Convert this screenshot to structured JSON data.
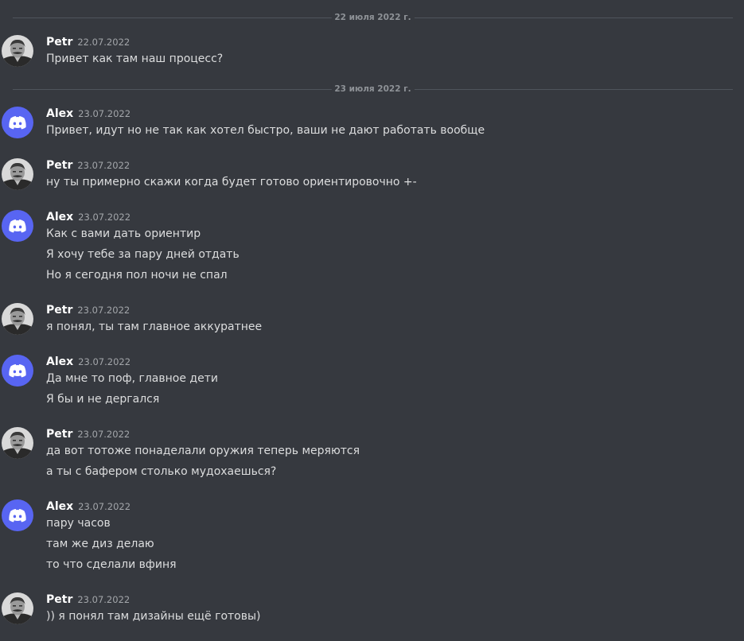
{
  "separators": [
    {
      "label": "22 июля 2022 г."
    },
    {
      "label": "23 июля 2022 г."
    }
  ],
  "messages": [
    {
      "author": "Petr",
      "timestamp": "22.07.2022",
      "avatar_icon": "portrait-avatar-icon",
      "lines": [
        "Привет как там наш процесс?"
      ]
    },
    {
      "author": "Alex",
      "timestamp": "23.07.2022",
      "avatar_icon": "discord-logo-icon",
      "lines": [
        "Привет, идут но не так как хотел быстро, ваши не дают работать вообще"
      ]
    },
    {
      "author": "Petr",
      "timestamp": "23.07.2022",
      "avatar_icon": "portrait-avatar-icon",
      "lines": [
        "ну ты примерно скажи когда будет готово ориентировочно +-"
      ]
    },
    {
      "author": "Alex",
      "timestamp": "23.07.2022",
      "avatar_icon": "discord-logo-icon",
      "lines": [
        "Как с вами дать ориентир",
        "Я хочу тебе за пару дней отдать",
        "Но я сегодня пол ночи не спал"
      ]
    },
    {
      "author": "Petr",
      "timestamp": "23.07.2022",
      "avatar_icon": "portrait-avatar-icon",
      "lines": [
        "я понял, ты там главное аккуратнее"
      ]
    },
    {
      "author": "Alex",
      "timestamp": "23.07.2022",
      "avatar_icon": "discord-logo-icon",
      "lines": [
        "Да мне то поф, главное дети",
        "Я бы и не дергался"
      ]
    },
    {
      "author": "Petr",
      "timestamp": "23.07.2022",
      "avatar_icon": "portrait-avatar-icon",
      "lines": [
        "да вот тотоже понаделали оружия теперь меряются",
        "а ты с бафером столько мудохаешься?"
      ]
    },
    {
      "author": "Alex",
      "timestamp": "23.07.2022",
      "avatar_icon": "discord-logo-icon",
      "lines": [
        "пару часов",
        "там же диз делаю",
        "то что сделали вфиня"
      ]
    },
    {
      "author": "Petr",
      "timestamp": "23.07.2022",
      "avatar_icon": "portrait-avatar-icon",
      "lines": [
        ")) я понял там дизайны ещё готовы)"
      ]
    }
  ],
  "colors": {
    "background": "#36393f",
    "discord_blurple": "#5865f2",
    "username": "#ffffff",
    "timestamp": "#a3a6aa",
    "text": "#dcddde"
  }
}
